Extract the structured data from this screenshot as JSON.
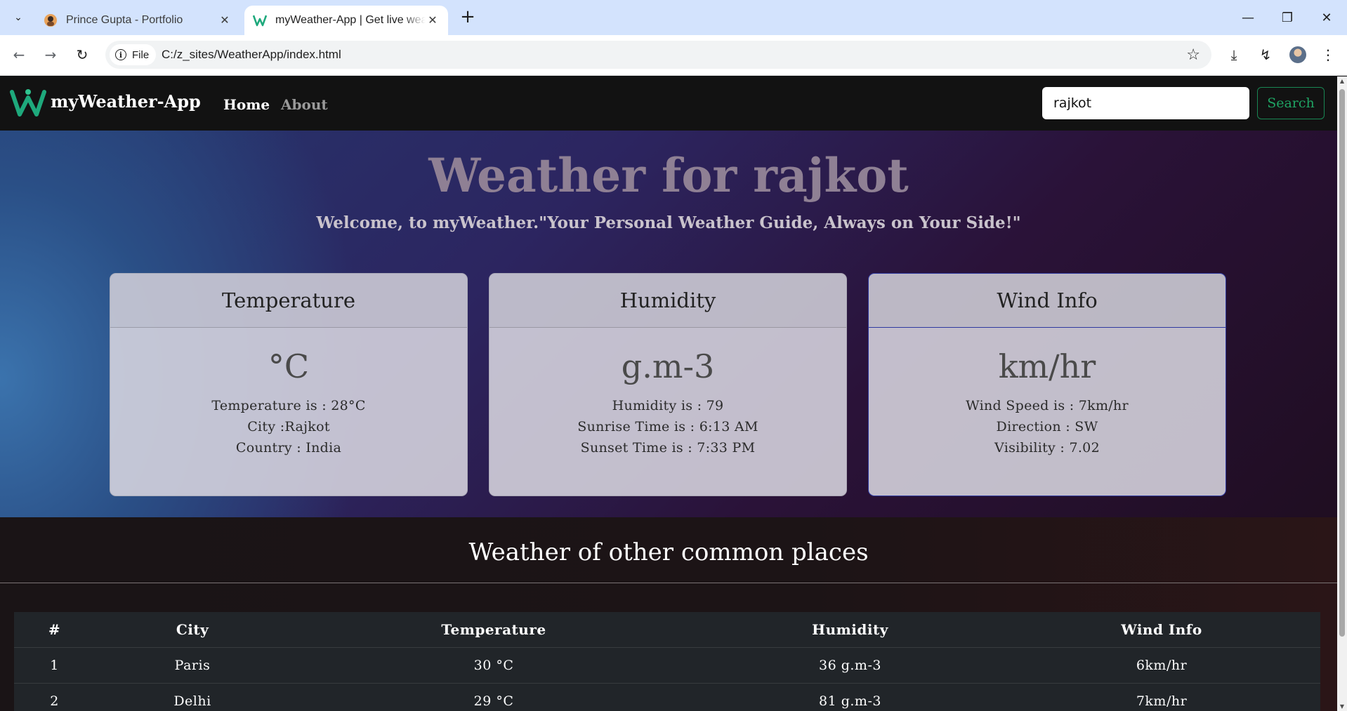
{
  "browser": {
    "tabs": [
      {
        "title": "Prince Gupta - Portfolio",
        "active": false
      },
      {
        "title": "myWeather-App | Get live weather",
        "active": true
      }
    ],
    "site_chip": "File",
    "url": "C:/z_sites/WeatherApp/index.html"
  },
  "navbar": {
    "brand": "myWeather-App",
    "links": [
      "Home",
      "About"
    ],
    "search_value": "rajkot",
    "search_button": "Search"
  },
  "hero": {
    "title": "Weather for rajkot",
    "subtitle": "Welcome, to myWeather.\"Your Personal Weather Guide, Always on Your Side!\""
  },
  "cards": [
    {
      "header": "Temperature",
      "unit": "°C",
      "lines": [
        "Temperature is : 28°C",
        "City :Rajkot",
        "Country : India"
      ]
    },
    {
      "header": "Humidity",
      "unit": "g.m-3",
      "lines": [
        "Humidity is : 79",
        "Sunrise Time is : 6:13 AM",
        "Sunset Time is : 7:33 PM"
      ]
    },
    {
      "header": "Wind Info",
      "unit": "km/hr",
      "lines": [
        "Wind Speed is : 7km/hr",
        "Direction : SW",
        "Visibility : 7.02"
      ]
    }
  ],
  "others": {
    "title": "Weather of other common places",
    "columns": [
      "#",
      "City",
      "Temperature",
      "Humidity",
      "Wind Info"
    ],
    "rows": [
      [
        "1",
        "Paris",
        "30 °C",
        "36 g.m-3",
        "6km/hr"
      ],
      [
        "2",
        "Delhi",
        "29 °C",
        "81 g.m-3",
        "7km/hr"
      ]
    ]
  },
  "colors": {
    "navbar_bg": "#121212",
    "search_button_accent": "#198754",
    "active_card_border": "#2f3aa0",
    "table_bg": "#212529"
  }
}
